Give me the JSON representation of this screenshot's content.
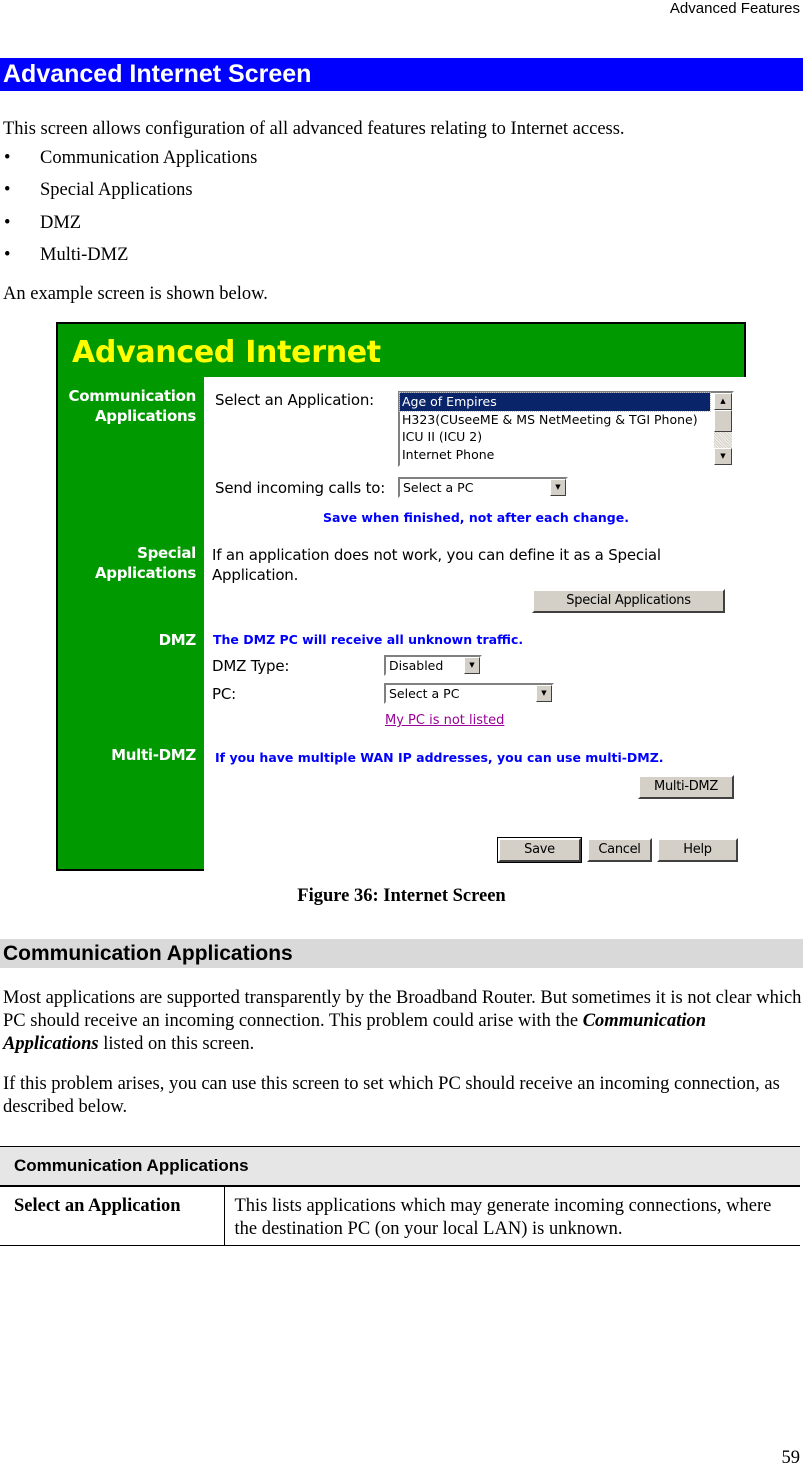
{
  "running_header": "Advanced Features",
  "section_title": "Advanced Internet Screen",
  "intro": "This screen allows configuration of all advanced features relating to Internet access.",
  "bullets": [
    "Communication Applications",
    "Special Applications",
    "DMZ",
    "Multi-DMZ"
  ],
  "bullet_glyph": "•",
  "example_text": "An example screen is shown below.",
  "screenshot": {
    "title": "Advanced Internet",
    "colors": {
      "panel_green": "#009900",
      "title_yellow": "#ffff00",
      "note_blue": "#0000ff",
      "link_purple": "#990099",
      "selected_navy": "#0a246a"
    },
    "communication": {
      "side_label_line1": "Communication",
      "side_label_line2": "Applications",
      "select_app_label": "Select an Application:",
      "applications": [
        "Age of Empires",
        "H323(CUseeME & MS NetMeeting & TGI Phone)",
        "ICU II (ICU 2)",
        "Internet Phone"
      ],
      "selected_application": "Age of Empires",
      "send_calls_label": "Send incoming calls to:",
      "send_calls_value": "Select a PC",
      "save_note": "Save when finished, not after each change."
    },
    "special": {
      "side_label_line1": "Special",
      "side_label_line2": "Applications",
      "text_line1": "If an application does not work, you can define it as a Special",
      "text_line2": "Application.",
      "button": "Special Applications"
    },
    "dmz": {
      "side_label": "DMZ",
      "note": "The DMZ PC will receive all unknown traffic.",
      "type_label": "DMZ Type:",
      "type_value": "Disabled",
      "pc_label": "PC:",
      "pc_value": "Select a PC",
      "not_listed_link": "My PC is not listed"
    },
    "multi_dmz": {
      "side_label": "Multi-DMZ",
      "note": "If you have multiple WAN IP addresses, you can use multi-DMZ.",
      "button": "Multi-DMZ"
    },
    "footer_buttons": {
      "save": "Save",
      "cancel": "Cancel",
      "help": "Help"
    },
    "icons": {
      "scroll_up": "▲",
      "scroll_down": "▼",
      "dropdown": "▼"
    }
  },
  "figure_caption": "Figure 36: Internet Screen",
  "subsection_title": "Communication Applications",
  "para1_start": "Most applications are supported transparently by the Broadband Router. But sometimes it is not clear which PC should receive an incoming connection. This problem could arise with the ",
  "para1_emph": "Communication Applications",
  "para1_end": " listed on this screen.",
  "para2": "If this problem arises, you can use this screen to set which PC should receive an incoming connection, as described below.",
  "table": {
    "header": "Communication Applications",
    "rows": [
      {
        "term": "Select an Application",
        "description": "This lists applications which may generate incoming connections, where the destination PC (on your local LAN) is unknown."
      }
    ]
  },
  "page_number": "59"
}
